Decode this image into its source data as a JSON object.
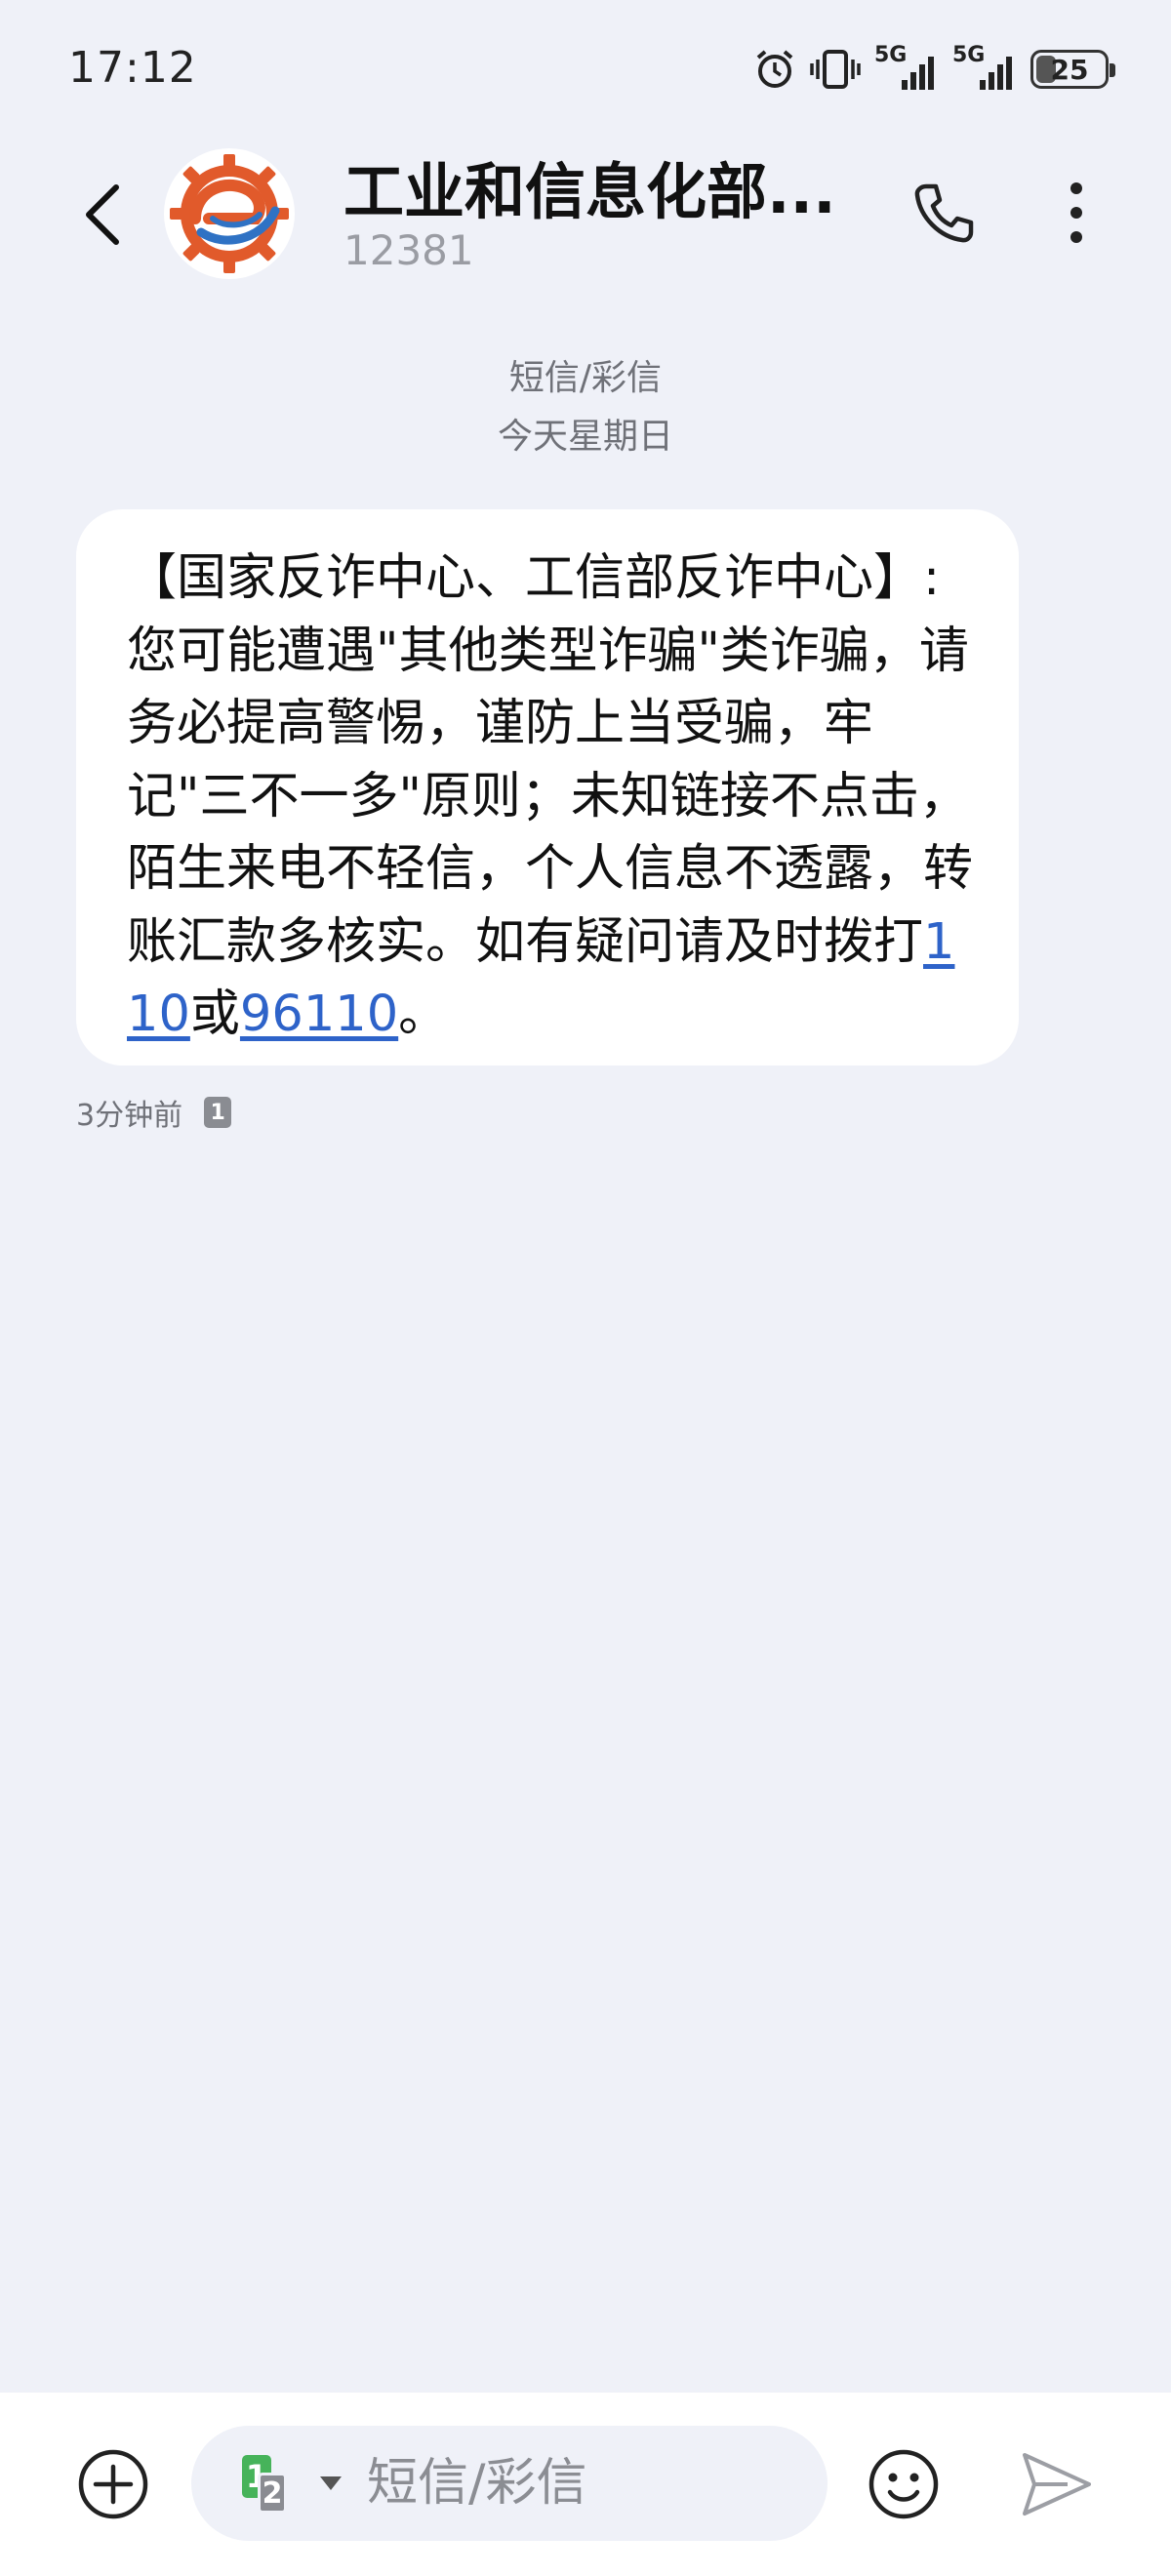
{
  "status_bar": {
    "time": "17:12",
    "battery": "25",
    "network_1": "5G",
    "network_2": "5G"
  },
  "header": {
    "contact_name": "工业和信息化部...",
    "contact_number": "12381",
    "icons": [
      "back-icon",
      "avatar-logo",
      "phone-icon",
      "more-vertical-icon"
    ]
  },
  "conversation": {
    "message_type": "短信/彩信",
    "date": "今天星期日",
    "messages": [
      {
        "text_before": "【国家反诈中心、工信部反诈中心】: 您可能遭遇\"其他类型诈骗\"类诈骗，请务必提高警惕，谨防上当受骗，牢记\"三不一多\"原则；未知链接不点击，陌生来电不轻信，个人信息不透露，转账汇款多核实。如有疑问请及时拨打",
        "link_1": "110",
        "text_between": "或",
        "link_2": "96110",
        "text_after": "。",
        "time": "3分钟前",
        "sim": "1"
      }
    ]
  },
  "input_bar": {
    "placeholder": "短信/彩信",
    "sim_primary": "1",
    "sim_secondary": "2",
    "colors": {
      "sim1": "#46b35a",
      "link": "#2e63c9"
    }
  }
}
